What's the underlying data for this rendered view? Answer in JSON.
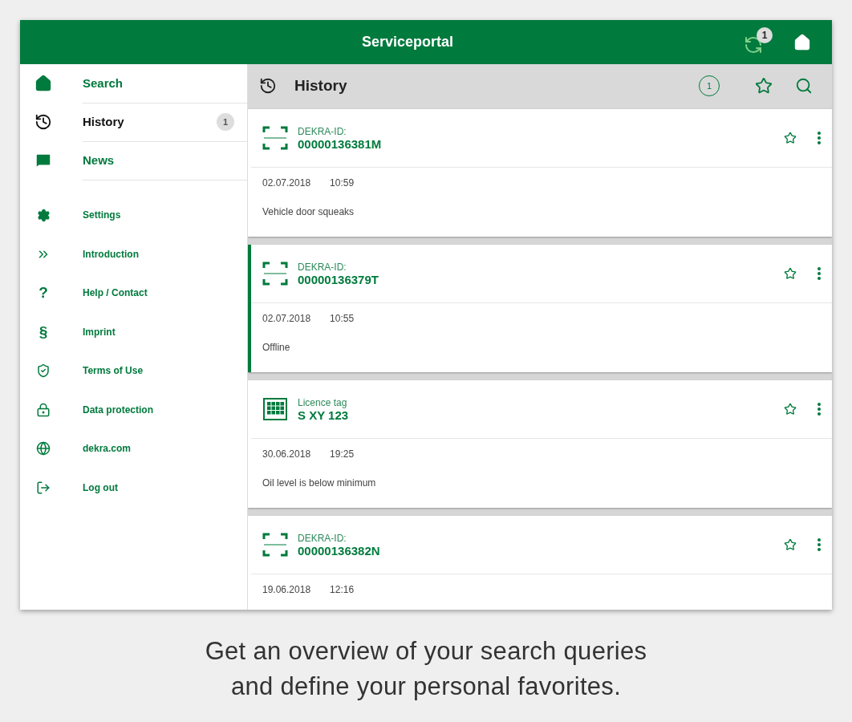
{
  "app_bar": {
    "title": "Serviceportal",
    "sync_badge": "1"
  },
  "sidebar": {
    "primary": [
      {
        "label": "Search",
        "selected": false
      },
      {
        "label": "History",
        "selected": true,
        "badge": "1"
      },
      {
        "label": "News",
        "selected": false
      }
    ],
    "secondary": [
      {
        "label": "Settings"
      },
      {
        "label": "Introduction"
      },
      {
        "label": "Help / Contact",
        "glyph": "?"
      },
      {
        "label": "Imprint",
        "glyph": "§"
      },
      {
        "label": "Terms of Use"
      },
      {
        "label": "Data protection"
      },
      {
        "label": "dekra.com"
      },
      {
        "label": "Log out"
      }
    ]
  },
  "header": {
    "title": "History",
    "count": "1"
  },
  "cards": [
    {
      "kind": "id",
      "label": "DEKRA-ID:",
      "value": "00000136381M",
      "date": "02.07.2018",
      "time": "10:59",
      "note": "Vehicle door squeaks",
      "selected": false
    },
    {
      "kind": "id",
      "label": "DEKRA-ID:",
      "value": "00000136379T",
      "date": "02.07.2018",
      "time": "10:55",
      "note": "Offline",
      "selected": true
    },
    {
      "kind": "plate",
      "label": "Licence tag",
      "value": "S XY 123",
      "date": "30.06.2018",
      "time": "19:25",
      "note": "Oil level is below minimum",
      "selected": false
    },
    {
      "kind": "id",
      "label": "DEKRA-ID:",
      "value": "00000136382N",
      "date": "19.06.2018",
      "time": "12:16",
      "selected": false
    }
  ],
  "caption": [
    "Get an overview of your search queries",
    "and define your personal favorites."
  ]
}
